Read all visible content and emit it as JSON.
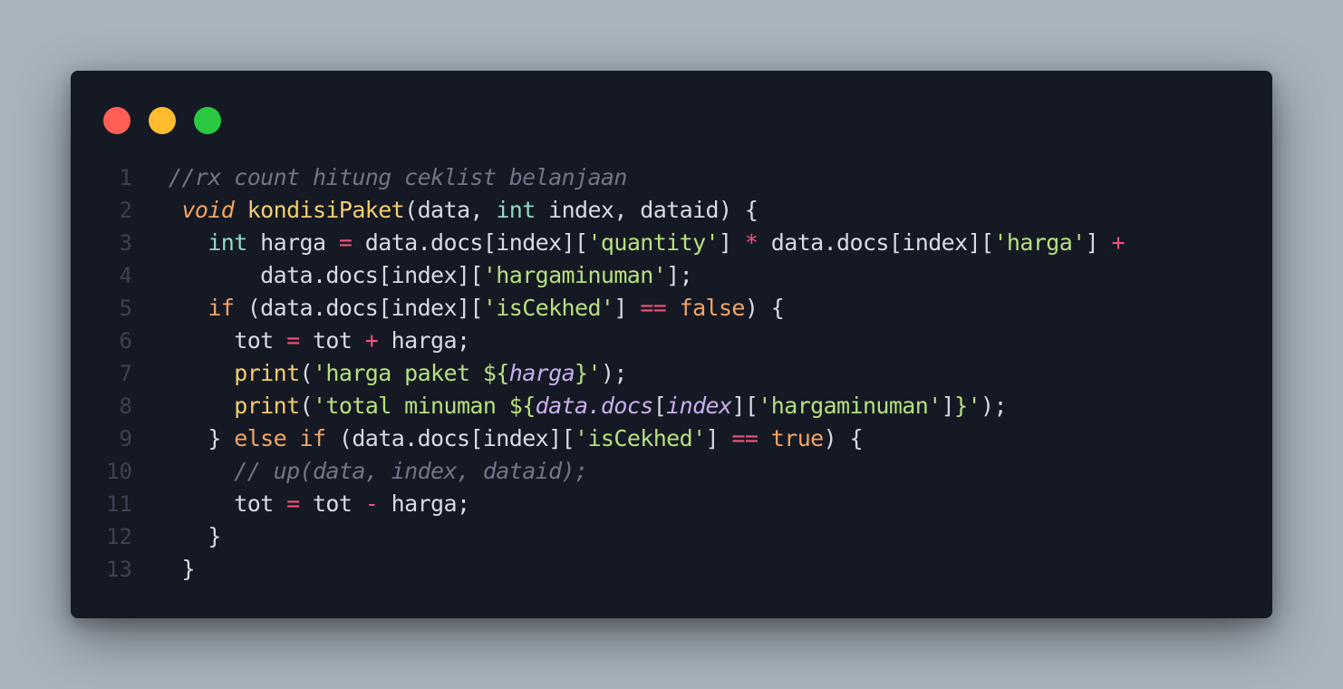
{
  "window": {
    "traffic_lights": [
      {
        "name": "close",
        "color": "#ff5f57"
      },
      {
        "name": "minimize",
        "color": "#febc2e"
      },
      {
        "name": "maximize",
        "color": "#28c840"
      }
    ]
  },
  "code": {
    "lines": [
      {
        "num": "1",
        "tokens": [
          {
            "t": "//rx count hitung ceklist belanjaan",
            "c": "comment"
          }
        ]
      },
      {
        "num": "2",
        "tokens": [
          {
            "t": " ",
            "c": "plain"
          },
          {
            "t": "void",
            "c": "kwi"
          },
          {
            "t": " ",
            "c": "plain"
          },
          {
            "t": "kondisiPaket",
            "c": "fn"
          },
          {
            "t": "(data, ",
            "c": "plain"
          },
          {
            "t": "int",
            "c": "type"
          },
          {
            "t": " index, dataid) {",
            "c": "plain"
          }
        ]
      },
      {
        "num": "3",
        "tokens": [
          {
            "t": "   ",
            "c": "plain"
          },
          {
            "t": "int",
            "c": "type"
          },
          {
            "t": " harga ",
            "c": "plain"
          },
          {
            "t": "=",
            "c": "op"
          },
          {
            "t": " data.docs[index][",
            "c": "plain"
          },
          {
            "t": "'quantity'",
            "c": "str"
          },
          {
            "t": "] ",
            "c": "plain"
          },
          {
            "t": "*",
            "c": "op"
          },
          {
            "t": " data.docs[index][",
            "c": "plain"
          },
          {
            "t": "'harga'",
            "c": "str"
          },
          {
            "t": "] ",
            "c": "plain"
          },
          {
            "t": "+",
            "c": "op"
          }
        ]
      },
      {
        "num": "4",
        "tokens": [
          {
            "t": "       data.docs[index][",
            "c": "plain"
          },
          {
            "t": "'hargaminuman'",
            "c": "str"
          },
          {
            "t": "];",
            "c": "plain"
          }
        ]
      },
      {
        "num": "5",
        "tokens": [
          {
            "t": "   ",
            "c": "plain"
          },
          {
            "t": "if",
            "c": "kw"
          },
          {
            "t": " (data.docs[index][",
            "c": "plain"
          },
          {
            "t": "'isCekhed'",
            "c": "str"
          },
          {
            "t": "] ",
            "c": "plain"
          },
          {
            "t": "==",
            "c": "op"
          },
          {
            "t": " ",
            "c": "plain"
          },
          {
            "t": "false",
            "c": "kw"
          },
          {
            "t": ") {",
            "c": "plain"
          }
        ]
      },
      {
        "num": "6",
        "tokens": [
          {
            "t": "     tot ",
            "c": "plain"
          },
          {
            "t": "=",
            "c": "op"
          },
          {
            "t": " tot ",
            "c": "plain"
          },
          {
            "t": "+",
            "c": "op"
          },
          {
            "t": " harga;",
            "c": "plain"
          }
        ]
      },
      {
        "num": "7",
        "tokens": [
          {
            "t": "     ",
            "c": "plain"
          },
          {
            "t": "print",
            "c": "fn"
          },
          {
            "t": "(",
            "c": "plain"
          },
          {
            "t": "'harga paket ${",
            "c": "str"
          },
          {
            "t": "harga",
            "c": "interp"
          },
          {
            "t": "}'",
            "c": "str"
          },
          {
            "t": ");",
            "c": "plain"
          }
        ]
      },
      {
        "num": "8",
        "tokens": [
          {
            "t": "     ",
            "c": "plain"
          },
          {
            "t": "print",
            "c": "fn"
          },
          {
            "t": "(",
            "c": "plain"
          },
          {
            "t": "'total minuman ${",
            "c": "str"
          },
          {
            "t": "data.docs",
            "c": "interp"
          },
          {
            "t": "[",
            "c": "plain"
          },
          {
            "t": "index",
            "c": "interp"
          },
          {
            "t": "][",
            "c": "plain"
          },
          {
            "t": "'hargaminuman'",
            "c": "str"
          },
          {
            "t": "]",
            "c": "plain"
          },
          {
            "t": "}'",
            "c": "str"
          },
          {
            "t": ");",
            "c": "plain"
          }
        ]
      },
      {
        "num": "9",
        "tokens": [
          {
            "t": "   } ",
            "c": "plain"
          },
          {
            "t": "else",
            "c": "kw"
          },
          {
            "t": " ",
            "c": "plain"
          },
          {
            "t": "if",
            "c": "kw"
          },
          {
            "t": " (data.docs[index][",
            "c": "plain"
          },
          {
            "t": "'isCekhed'",
            "c": "str"
          },
          {
            "t": "] ",
            "c": "plain"
          },
          {
            "t": "==",
            "c": "op"
          },
          {
            "t": " ",
            "c": "plain"
          },
          {
            "t": "true",
            "c": "kw"
          },
          {
            "t": ") {",
            "c": "plain"
          }
        ]
      },
      {
        "num": "10",
        "tokens": [
          {
            "t": "     ",
            "c": "plain"
          },
          {
            "t": "// up(data, index, dataid);",
            "c": "comment"
          }
        ]
      },
      {
        "num": "11",
        "tokens": [
          {
            "t": "     tot ",
            "c": "plain"
          },
          {
            "t": "=",
            "c": "op"
          },
          {
            "t": " tot ",
            "c": "plain"
          },
          {
            "t": "-",
            "c": "op"
          },
          {
            "t": " harga;",
            "c": "plain"
          }
        ]
      },
      {
        "num": "12",
        "tokens": [
          {
            "t": "   }",
            "c": "plain"
          }
        ]
      },
      {
        "num": "13",
        "tokens": [
          {
            "t": " }",
            "c": "plain"
          }
        ]
      }
    ]
  }
}
